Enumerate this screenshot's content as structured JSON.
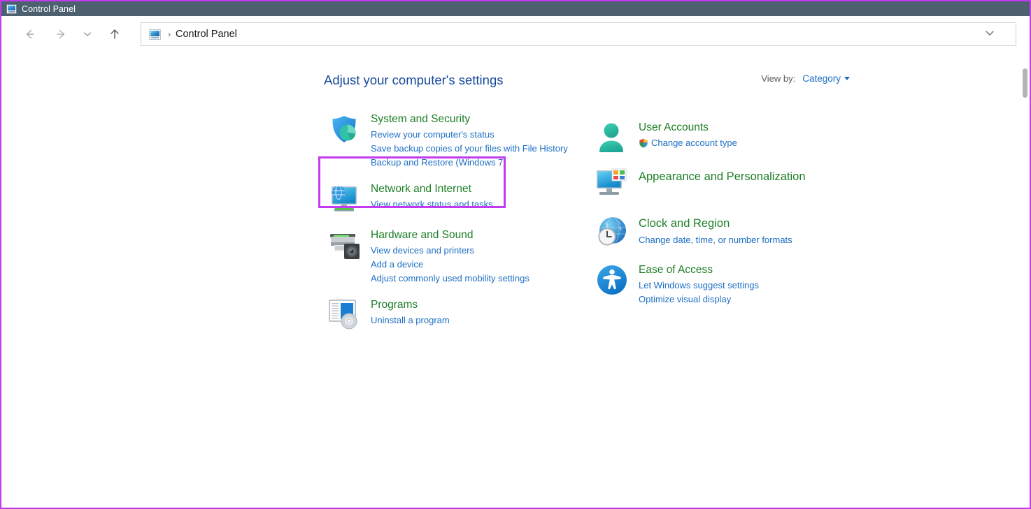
{
  "window": {
    "title": "Control Panel",
    "title_icon": "control-panel-icon"
  },
  "nav": {
    "back_icon": "arrow-left-icon",
    "forward_icon": "arrow-right-icon",
    "recent_icon": "chevron-down-icon",
    "up_icon": "arrow-up-icon",
    "address_icon": "control-panel-icon",
    "separator": "›",
    "breadcrumb": "Control Panel",
    "dropdown_icon": "chevron-down-icon"
  },
  "main": {
    "heading": "Adjust your computer's settings",
    "view_by": {
      "label": "View by:",
      "value": "Category",
      "caret_icon": "caret-down-icon"
    }
  },
  "categories": {
    "left": [
      {
        "title": "System and Security",
        "icon": "shield-security-icon",
        "links": [
          "Review your computer's status",
          "Save backup copies of your files with File History",
          "Backup and Restore (Windows 7)"
        ]
      },
      {
        "title": "Network and Internet",
        "icon": "network-globe-monitor-icon",
        "links": [
          "View network status and tasks"
        ]
      },
      {
        "title": "Hardware and Sound",
        "icon": "printer-speaker-icon",
        "links": [
          "View devices and printers",
          "Add a device",
          "Adjust commonly used mobility settings"
        ]
      },
      {
        "title": "Programs",
        "icon": "programs-disc-icon",
        "links": [
          "Uninstall a program"
        ]
      }
    ],
    "right": [
      {
        "title": "User Accounts",
        "icon": "user-person-icon",
        "highlighted": true,
        "links": [
          "Change account type"
        ],
        "link_icons": [
          "uac-shield-icon"
        ]
      },
      {
        "title": "Appearance and Personalization",
        "icon": "appearance-monitor-icon",
        "links": []
      },
      {
        "title": "Clock and Region",
        "icon": "clock-globe-icon",
        "links": [
          "Change date, time, or number formats"
        ]
      },
      {
        "title": "Ease of Access",
        "icon": "ease-of-access-icon",
        "links": [
          "Let Windows suggest settings",
          "Optimize visual display"
        ]
      }
    ]
  },
  "colors": {
    "titlebar": "#4d6070",
    "highlight_border": "#c23bf0",
    "heading_blue": "#15499b",
    "category_green": "#1d7f26",
    "link_blue": "#1e6fc4"
  }
}
